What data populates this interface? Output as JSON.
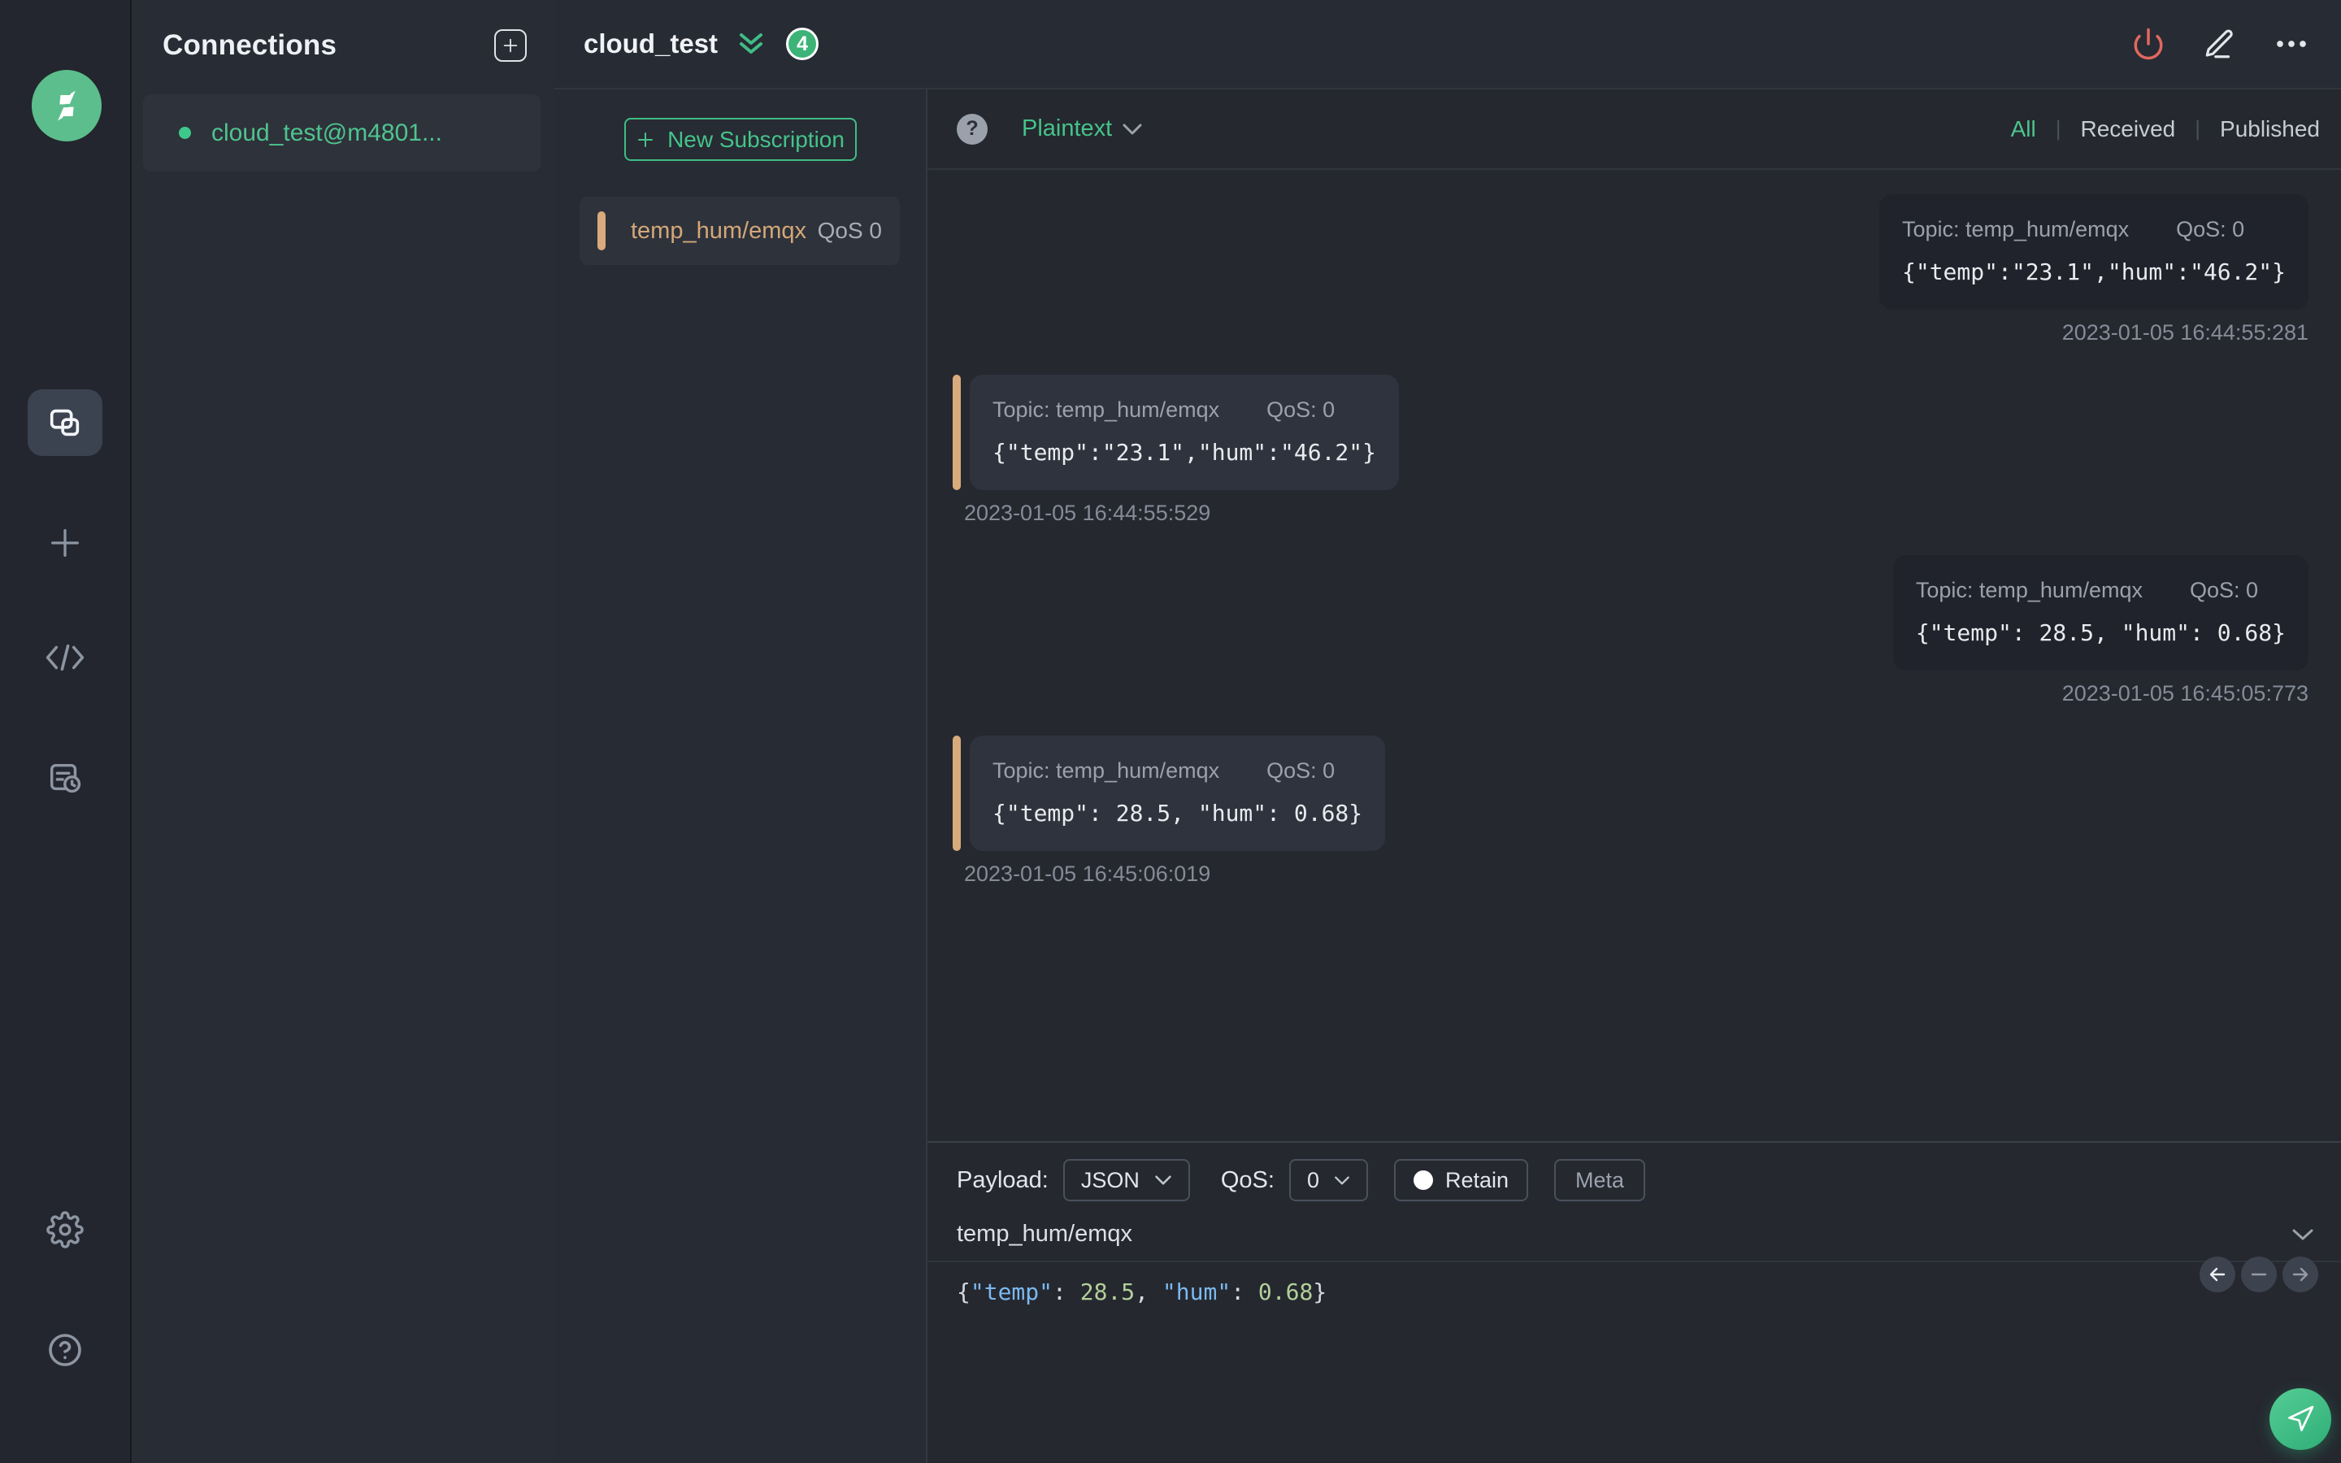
{
  "colors": {
    "accent_green": "#3ec98b",
    "subscription_orange": "#d9ab7c",
    "disconnect_red": "#e0685f",
    "badge_green": "#3db378",
    "received_card_bg": "#2f333d",
    "published_card_bg": "#20232b"
  },
  "sidebar": {
    "icons": [
      "mqttx-logo",
      "connections-icon",
      "new-connection-icon",
      "script-icon",
      "log-icon",
      "settings-icon",
      "help-icon"
    ]
  },
  "connections": {
    "title": "Connections",
    "items": [
      {
        "label": "cloud_test@m4801...",
        "status": "connected"
      }
    ]
  },
  "header": {
    "title": "cloud_test",
    "message_count": "4"
  },
  "subscriptions": {
    "new_label": "New Subscription",
    "items": [
      {
        "topic": "temp_hum/emqx",
        "qos": "QoS 0"
      }
    ]
  },
  "messages": {
    "format": "Plaintext",
    "filters": {
      "all": "All",
      "received": "Received",
      "published": "Published",
      "active": "All"
    },
    "items": [
      {
        "direction": "published",
        "topic_label": "Topic: temp_hum/emqx",
        "qos_label": "QoS: 0",
        "payload": "{\"temp\":\"23.1\",\"hum\":\"46.2\"}",
        "timestamp": "2023-01-05 16:44:55:281"
      },
      {
        "direction": "received",
        "topic_label": "Topic: temp_hum/emqx",
        "qos_label": "QoS: 0",
        "payload": "{\"temp\":\"23.1\",\"hum\":\"46.2\"}",
        "timestamp": "2023-01-05 16:44:55:529"
      },
      {
        "direction": "published",
        "topic_label": "Topic: temp_hum/emqx",
        "qos_label": "QoS: 0",
        "payload": "{\"temp\": 28.5, \"hum\": 0.68}",
        "timestamp": "2023-01-05 16:45:05:773"
      },
      {
        "direction": "received",
        "topic_label": "Topic: temp_hum/emqx",
        "qos_label": "QoS: 0",
        "payload": "{\"temp\": 28.5, \"hum\": 0.68}",
        "timestamp": "2023-01-05 16:45:06:019"
      }
    ]
  },
  "publish": {
    "payload_label": "Payload:",
    "format_value": "JSON",
    "qos_label": "QoS:",
    "qos_value": "0",
    "retain_label": "Retain",
    "meta_label": "Meta",
    "topic": "temp_hum/emqx",
    "payload_tokens": {
      "open": "{",
      "key1": "\"temp\"",
      "sep1": ": ",
      "val1": "28.5",
      "comma": ", ",
      "key2": "\"hum\"",
      "sep2": ": ",
      "val2": "0.68",
      "close": "}"
    }
  }
}
